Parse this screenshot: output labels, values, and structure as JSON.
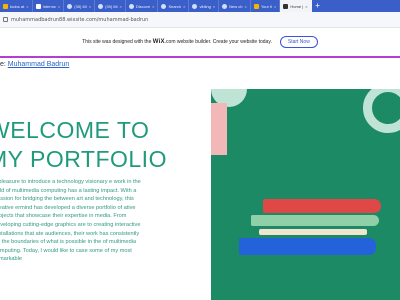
{
  "browser": {
    "tabs": [
      {
        "label": "todos at",
        "active": false
      },
      {
        "label": "Intermc",
        "active": false
      },
      {
        "label": "(35) Mi",
        "active": false
      },
      {
        "label": "(35) Mi",
        "active": false
      },
      {
        "label": "Discove",
        "active": false
      },
      {
        "label": "Search",
        "active": false
      },
      {
        "label": "vibling",
        "active": false
      },
      {
        "label": "New ch",
        "active": false
      },
      {
        "label": "Your fi",
        "active": false
      },
      {
        "label": "Home |",
        "active": true
      }
    ],
    "new_tab": "+",
    "close_glyph": "×",
    "url": "muhammadbadrun88.wixsite.com/muhammad-badrun"
  },
  "banner": {
    "text_before": "This site was designed with the ",
    "brand": "WiX",
    "brand_suffix": ".com",
    "text_after": " website builder. Create your website today.",
    "button": "Start Now",
    "accent": "#b23fd0"
  },
  "page": {
    "byline_prefix": "e: ",
    "author": "Muhammad Badrun",
    "headline_line1": "WELCOME TO",
    "headline_line2": "MY PORTFOLIO",
    "body": "y pleasure to introduce a technology visionary e work in the field of multimedia computing has a lasting impact. With a passion for bridging the between art and technology, this creative ermind has developed a diverse portfolio of ative projects that showcase their expertise in media. From developing cutting-edge graphics are to creating interactive installations that ate audiences, their work has consistently ed the boundaries of what is possible in the of multimedia computing. Today, I would like to case some of my most remarkable",
    "accent": "#1f9a7c"
  }
}
